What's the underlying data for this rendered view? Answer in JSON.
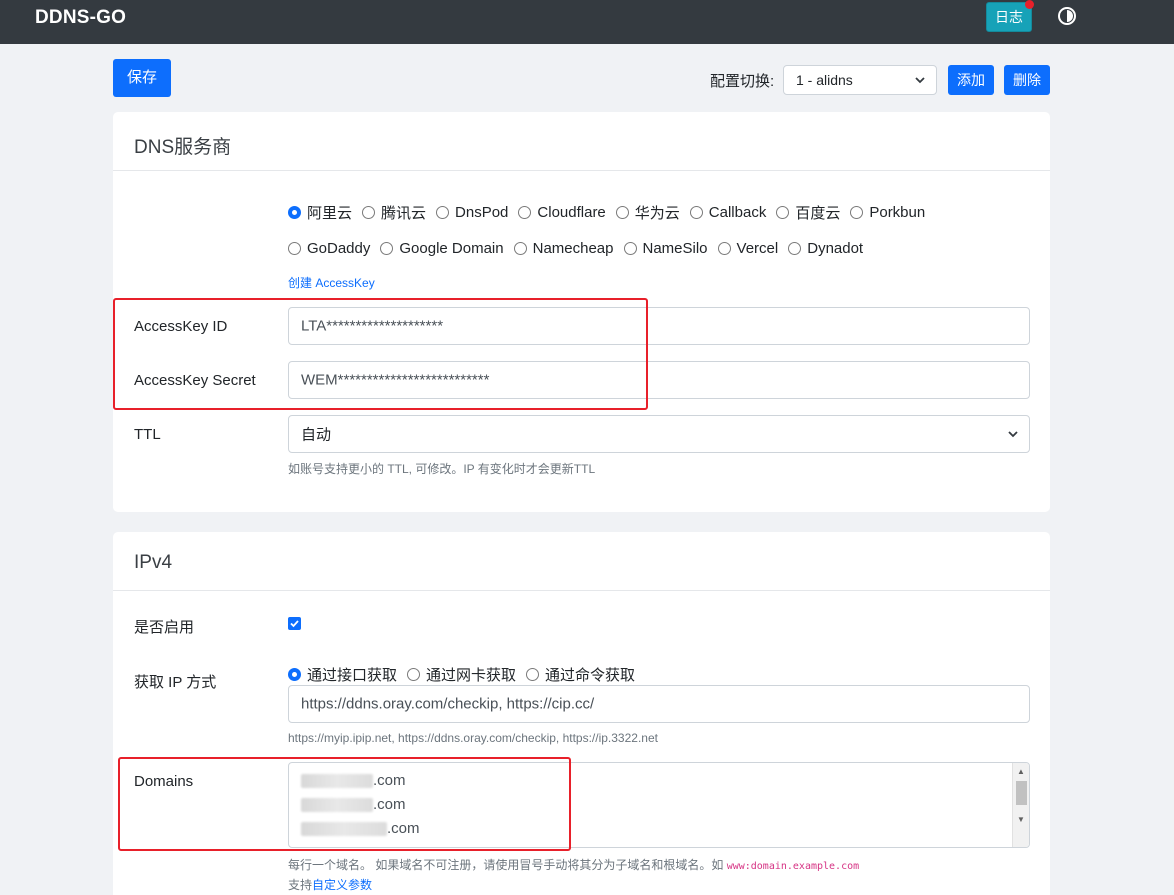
{
  "navbar": {
    "brand": "DDNS-GO",
    "log_label": "日志"
  },
  "toolbar": {
    "save_label": "保存",
    "config_label": "配置切换:",
    "config_selected": "1 - alidns",
    "add_label": "添加",
    "delete_label": "删除"
  },
  "dns_card": {
    "title": "DNS服务商",
    "providers_row1": [
      "阿里云",
      "腾讯云",
      "DnsPod",
      "Cloudflare",
      "华为云",
      "Callback",
      "百度云",
      "Porkbun"
    ],
    "providers_row2": [
      "GoDaddy",
      "Google Domain",
      "Namecheap",
      "NameSilo",
      "Vercel",
      "Dynadot"
    ],
    "selected_provider": "阿里云",
    "create_key_link": "创建 AccessKey",
    "access_key_id_label": "AccessKey ID",
    "access_key_id_value": "LTA********************",
    "access_key_secret_label": "AccessKey Secret",
    "access_key_secret_value": "WEM**************************",
    "ttl_label": "TTL",
    "ttl_value": "自动",
    "ttl_hint": "如账号支持更小的 TTL, 可修改。IP 有变化时才会更新TTL"
  },
  "ipv4_card": {
    "title": "IPv4",
    "enabled_label": "是否启用",
    "enabled": true,
    "get_ip_label": "获取 IP 方式",
    "get_ip_options": [
      "通过接口获取",
      "通过网卡获取",
      "通过命令获取"
    ],
    "get_ip_selected": "通过接口获取",
    "url_value": "https://ddns.oray.com/checkip, https://cip.cc/",
    "url_hint": "https://myip.ipip.net, https://ddns.oray.com/checkip, https://ip.3322.net",
    "domains_label": "Domains",
    "domains": [
      ".com",
      ".com",
      ".com"
    ],
    "domains_hint": "每行一个域名。 如果域名不可注册，请使用冒号手动将其分为子域名和根域名。如",
    "domains_hint_code": "www:domain.example.com",
    "custom_params_prefix": "支持",
    "custom_params_link": "自定义参数"
  },
  "colors": {
    "primary": "#0d6efd",
    "info": "#17a2b8",
    "navbar": "#343a40",
    "highlight": "#e8202a"
  }
}
